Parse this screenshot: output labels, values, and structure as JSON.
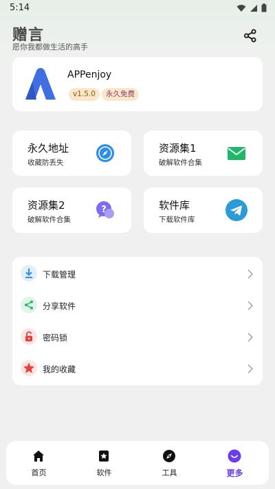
{
  "status_bar": {
    "time": "5:14"
  },
  "header": {
    "title": "赠言",
    "subtitle": "愿你我都做生活的高手",
    "share_icon": "share-icon"
  },
  "app": {
    "name": "APPenjoy",
    "version": "v1.5.0",
    "tag": "永久免费"
  },
  "tiles": [
    {
      "title": "永久地址",
      "subtitle": "收藏防丢失",
      "icon": "compass-icon"
    },
    {
      "title": "资源集1",
      "subtitle": "破解软件合集",
      "icon": "mail-icon"
    },
    {
      "title": "资源集2",
      "subtitle": "破解软件合集",
      "icon": "question-chat-icon"
    },
    {
      "title": "软件库",
      "subtitle": "下载软件库",
      "icon": "telegram-icon"
    }
  ],
  "menu": [
    {
      "label": "下载管理",
      "icon": "download-icon"
    },
    {
      "label": "分享软件",
      "icon": "share-icon"
    },
    {
      "label": "密码锁",
      "icon": "lock-icon"
    },
    {
      "label": "我的收藏",
      "icon": "star-icon"
    }
  ],
  "nav": [
    {
      "label": "首页",
      "icon": "home-icon"
    },
    {
      "label": "软件",
      "icon": "star-bookmark-icon"
    },
    {
      "label": "工具",
      "icon": "compass-icon"
    },
    {
      "label": "更多",
      "icon": "smile-icon",
      "active": true
    }
  ],
  "colors": {
    "accent": "#6a3df0",
    "tile_blue": "#2b8ee8",
    "mail_green": "#1fb86b",
    "question_purple": "#7b6cf0",
    "telegram_blue": "#2a9ad8"
  }
}
